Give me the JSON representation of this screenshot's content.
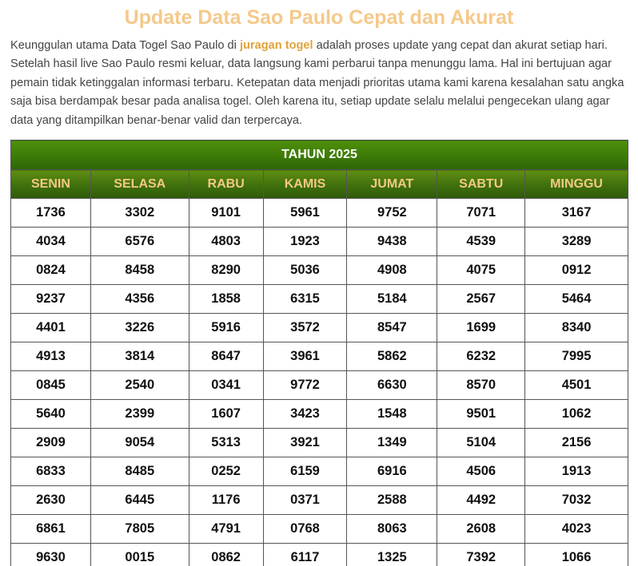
{
  "heading": "Update Data Sao Paulo Cepat dan Akurat",
  "intro": {
    "before_link": "Keunggulan utama Data Togel Sao Paulo di ",
    "link_text": "juragan togel",
    "after_link": " adalah proses update yang cepat dan akurat setiap hari. Setelah hasil live Sao Paulo resmi keluar, data langsung kami perbarui tanpa menunggu lama. Hal ini bertujuan agar pemain tidak ketinggalan informasi terbaru. Ketepatan data menjadi prioritas utama kami karena kesalahan satu angka saja bisa berdampak besar pada analisa togel. Oleh karena itu, setiap update selalu melalui pengecekan ulang agar data yang ditampilkan benar-benar valid dan terpercaya."
  },
  "colors": {
    "title": "#f5c98a",
    "link": "#e0a23a",
    "header_green": "#3c7a08",
    "day_text": "#f4c983"
  },
  "table": {
    "year_label": "TAHUN 2025",
    "days": [
      "SENIN",
      "SELASA",
      "RABU",
      "KAMIS",
      "JUMAT",
      "SABTU",
      "MINGGU"
    ],
    "rows": [
      [
        "1736",
        "3302",
        "9101",
        "5961",
        "9752",
        "7071",
        "3167"
      ],
      [
        "4034",
        "6576",
        "4803",
        "1923",
        "9438",
        "4539",
        "3289"
      ],
      [
        "0824",
        "8458",
        "8290",
        "5036",
        "4908",
        "4075",
        "0912"
      ],
      [
        "9237",
        "4356",
        "1858",
        "6315",
        "5184",
        "2567",
        "5464"
      ],
      [
        "4401",
        "3226",
        "5916",
        "3572",
        "8547",
        "1699",
        "8340"
      ],
      [
        "4913",
        "3814",
        "8647",
        "3961",
        "5862",
        "6232",
        "7995"
      ],
      [
        "0845",
        "2540",
        "0341",
        "9772",
        "6630",
        "8570",
        "4501"
      ],
      [
        "5640",
        "2399",
        "1607",
        "3423",
        "1548",
        "9501",
        "1062"
      ],
      [
        "2909",
        "9054",
        "5313",
        "3921",
        "1349",
        "5104",
        "2156"
      ],
      [
        "6833",
        "8485",
        "0252",
        "6159",
        "6916",
        "4506",
        "1913"
      ],
      [
        "2630",
        "6445",
        "1176",
        "0371",
        "2588",
        "4492",
        "7032"
      ],
      [
        "6861",
        "7805",
        "4791",
        "0768",
        "8063",
        "2608",
        "4023"
      ],
      [
        "9630",
        "0015",
        "0862",
        "6117",
        "1325",
        "7392",
        "1066"
      ]
    ]
  }
}
